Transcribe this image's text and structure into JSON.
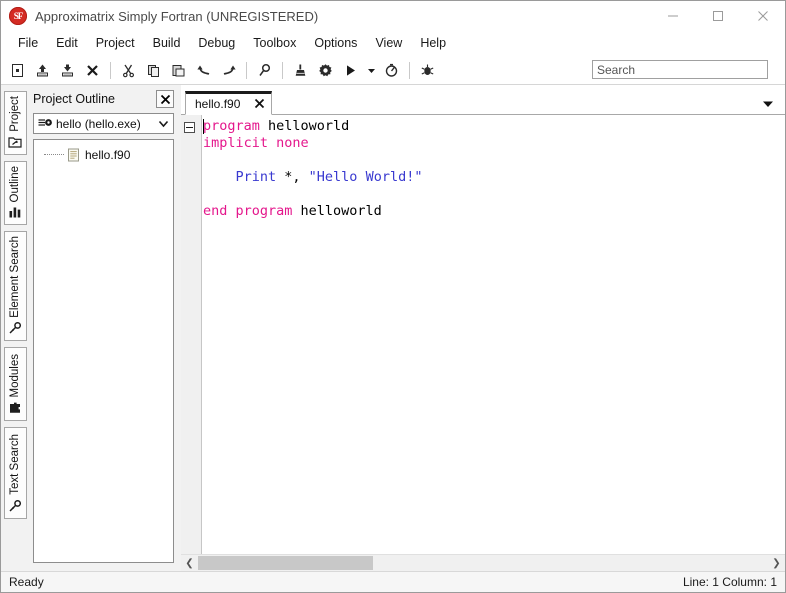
{
  "window": {
    "title": "Approximatrix Simply Fortran (UNREGISTERED)",
    "logo_text": "SF",
    "controls": {
      "minimize": "minimize-button",
      "maximize": "maximize-button",
      "close": "close-button"
    }
  },
  "menu": {
    "items": [
      {
        "label": "File"
      },
      {
        "label": "Edit"
      },
      {
        "label": "Project"
      },
      {
        "label": "Build"
      },
      {
        "label": "Debug"
      },
      {
        "label": "Toolbox"
      },
      {
        "label": "Options"
      },
      {
        "label": "View"
      },
      {
        "label": "Help"
      }
    ]
  },
  "toolbar": {
    "buttons": [
      {
        "name": "new-file-icon"
      },
      {
        "name": "open-file-icon"
      },
      {
        "name": "save-file-icon"
      },
      {
        "name": "close-file-icon"
      },
      {
        "name": "separator"
      },
      {
        "name": "cut-icon"
      },
      {
        "name": "copy-icon"
      },
      {
        "name": "paste-icon"
      },
      {
        "name": "undo-icon"
      },
      {
        "name": "redo-icon"
      },
      {
        "name": "separator"
      },
      {
        "name": "find-icon"
      },
      {
        "name": "separator"
      },
      {
        "name": "clean-icon"
      },
      {
        "name": "build-icon"
      },
      {
        "name": "run-icon"
      },
      {
        "name": "run-options-chevron-icon"
      },
      {
        "name": "rebuild-icon"
      },
      {
        "name": "separator"
      },
      {
        "name": "debug-icon"
      }
    ]
  },
  "search": {
    "placeholder": "Search",
    "value": ""
  },
  "sidebar": {
    "tabs": [
      {
        "label": "Project",
        "icon": "folder-icon",
        "active": true
      },
      {
        "label": "Outline",
        "icon": "bar-chart-icon",
        "active": false
      },
      {
        "label": "Element Search",
        "icon": "key-search-icon",
        "active": false
      },
      {
        "label": "Modules",
        "icon": "puzzle-icon",
        "active": false
      },
      {
        "label": "Text Search",
        "icon": "key-search-icon",
        "active": false
      }
    ]
  },
  "project_panel": {
    "title": "Project Outline",
    "close_label": "✕",
    "project_select": {
      "value": "hello (hello.exe)",
      "icon": "executable-icon",
      "chevron": "chevron-down-icon"
    },
    "tree": [
      {
        "label": "hello.f90",
        "icon": "source-file-icon"
      }
    ]
  },
  "editor": {
    "tabs": [
      {
        "label": "hello.f90",
        "close": "✕",
        "active": true
      }
    ],
    "tab_menu_icon": "chevron-down-icon",
    "fold_marker": "collapse-box",
    "code": {
      "line1_kw": "program",
      "line1_name": " helloworld",
      "line2_kw": "implicit none",
      "line4_fn": "    Print",
      "line4_punct": " *, ",
      "line4_str": "\"Hello World!\"",
      "line6_kw": "end program",
      "line6_name": " helloworld"
    },
    "scrollbar": {
      "left_arrow": "❮",
      "right_arrow": "❯"
    }
  },
  "statusbar": {
    "message": "Ready",
    "position": "Line: 1 Column: 1"
  },
  "colors": {
    "keyword": "#e4178c",
    "string": "#3a3ad0",
    "function": "#3a3ad0",
    "logo": "#d42b23"
  }
}
